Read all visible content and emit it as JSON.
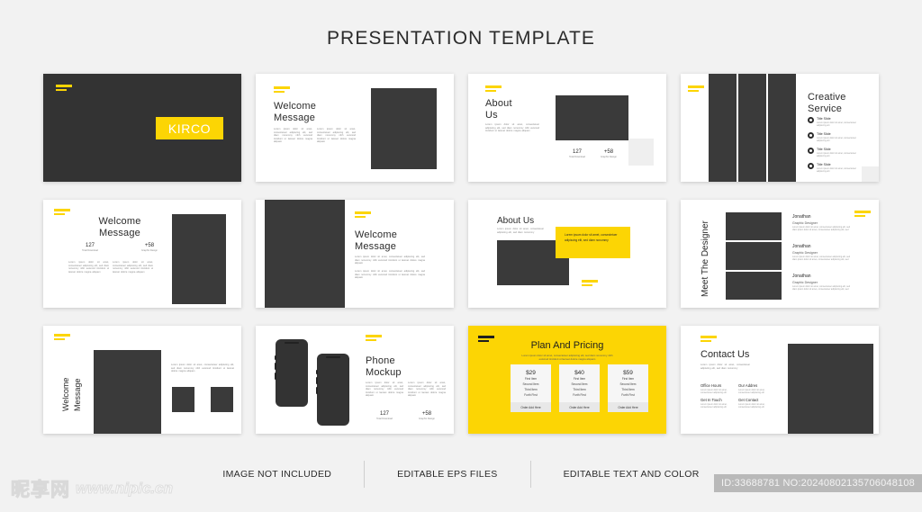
{
  "header": {
    "title": "PRESENTATION TEMPLATE"
  },
  "common": {
    "lorem_short": "Lorem ipsum dolor sit amet, consectetuer adipiscing elit, sed diam nonummy nibh euismod tincidunt ut laoreet dolore magna aliquam",
    "lorem_mid": "Lorem ipsum dolor sit amet, consectetuer adipiscing elit, sed diam nonummy nibh euismod tincidunt ut laoreet dolore magna aliquam",
    "lorem_tiny": "Lorem ipsum dolor sit amet, consectetuer adipiscing elit",
    "stat1_value": "127",
    "stat1_label": "Total Download",
    "stat2_value": "+58",
    "stat2_label": "Graphic Design"
  },
  "slides": [
    {
      "id": "cover",
      "logo": "KIRCO"
    },
    {
      "id": "welcome-message-1",
      "title_line1": "Welcome",
      "title_line2": "Message"
    },
    {
      "id": "about-us-1",
      "title_line1": "About",
      "title_line2": "Us"
    },
    {
      "id": "creative-service",
      "title_line1": "Creative",
      "title_line2": "Service",
      "items": [
        {
          "label": "Title Slide",
          "text": "Lorem ipsum dolor sit amet, consectetuer adipiscing elit"
        },
        {
          "label": "Title Slide",
          "text": "Lorem ipsum dolor sit amet, consectetuer adipiscing elit"
        },
        {
          "label": "Title Slide",
          "text": "Lorem ipsum dolor sit amet, consectetuer adipiscing elit"
        },
        {
          "label": "Title Slide",
          "text": "Lorem ipsum dolor sit amet, consectetuer adipiscing elit"
        }
      ]
    },
    {
      "id": "welcome-message-2",
      "title_line1": "Welcome",
      "title_line2": "Message"
    },
    {
      "id": "welcome-message-3",
      "title_line1": "Welcome",
      "title_line2": "Message"
    },
    {
      "id": "about-us-2",
      "title": "About Us",
      "intro": "Lorem ipsum dolor sit amet, consectetuer adipiscing elit, sed diam nonummy",
      "callout": "Lorem ipsum dolor sit amet, consectetuer adipiscing elit, sed diam nonummy"
    },
    {
      "id": "meet-the-designer",
      "title": "Meet The Designer",
      "designers": [
        {
          "name": "Jonathan",
          "role": "Graphic Designer",
          "text": "Lorem ipsum dolor sit amet, consectetuer adipiscing elit, sed diam ipsum dolor sit amet, consectetuer adipiscing elit, sed"
        },
        {
          "name": "Jonathan",
          "role": "Graphic Designer",
          "text": "Lorem ipsum dolor sit amet, consectetuer adipiscing elit, sed diam ipsum dolor sit amet, consectetuer adipiscing elit, sed"
        },
        {
          "name": "Jonathan",
          "role": "Graphic Designer",
          "text": "Lorem ipsum dolor sit amet, consectetuer adipiscing elit, sed diam ipsum dolor sit amet, consectetuer adipiscing elit, sed"
        }
      ]
    },
    {
      "id": "welcome-message-4",
      "title_line1": "Welcome",
      "title_line2": "Message"
    },
    {
      "id": "phone-mockup",
      "title_line1": "Phone",
      "title_line2": "Mockup"
    },
    {
      "id": "plan-and-pricing",
      "title": "Plan And Pricing",
      "subtitle": "Lorem ipsum dolor sit amet, consectetuer adipiscing elit, sed diam nonummy nibh euismod tincidunt ut laoreet dolore magna aliquam",
      "cards": [
        {
          "price": "$29",
          "items": [
            "First Item",
            "Second Item",
            "Third Item",
            "Furth First"
          ],
          "cta": "Order Add Here"
        },
        {
          "price": "$40",
          "items": [
            "First Item",
            "Second Item",
            "Third Item",
            "Furth First"
          ],
          "cta": "Order Add Here"
        },
        {
          "price": "$59",
          "items": [
            "First Item",
            "Second Item",
            "Third Item",
            "Furth First"
          ],
          "cta": "Order Add Here"
        }
      ]
    },
    {
      "id": "contact-us",
      "title": "Contact Us",
      "intro": "Lorem ipsum dolor sit amet, consectetuer adipiscing elit, sed diam nonummy",
      "blocks": [
        {
          "heading": "Office Hours",
          "text": "Lorem ipsum dolor sit amet, consectetuer adipiscing elit"
        },
        {
          "heading": "Our Addres",
          "text": "Lorem ipsum dolor sit amet, consectetuer adipiscing elit"
        },
        {
          "heading": "Get In Touch",
          "text": "Lorem ipsum dolor sit amet, consectetuer adipiscing elit"
        },
        {
          "heading": "Get Contact",
          "text": "Lorem ipsum dolor sit amet, consectetuer adipiscing elit"
        }
      ]
    }
  ],
  "footer": {
    "features": [
      "IMAGE NOT INCLUDED",
      "EDITABLE EPS FILES",
      "EDITABLE TEXT AND COLOR"
    ],
    "watermark_cn": "昵享网",
    "watermark_url": "www.nipic.cn",
    "id_badge": "ID:33688781 NO:20240802135706048108"
  },
  "colors": {
    "accent_yellow": "#fcd504",
    "dark": "#333333",
    "page_bg": "#f2f2f2"
  }
}
